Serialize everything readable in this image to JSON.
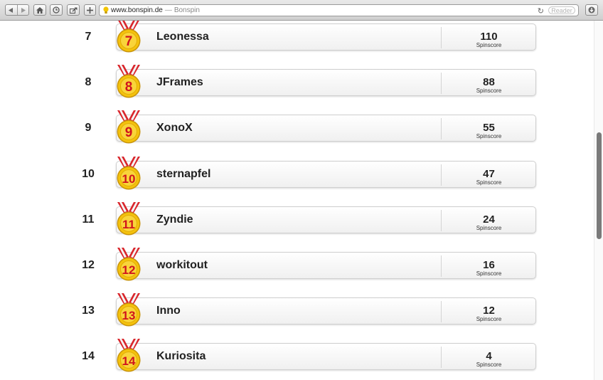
{
  "browser": {
    "address": "www.bonspin.de",
    "separator": "—",
    "site_title": "Bonspin",
    "reader_label": "Reader"
  },
  "score_label": "Spinscore",
  "rows": [
    {
      "rank": "7",
      "medal": "7",
      "name": "Leonessa",
      "score": "110"
    },
    {
      "rank": "8",
      "medal": "8",
      "name": "JFrames",
      "score": "88"
    },
    {
      "rank": "9",
      "medal": "9",
      "name": "XonoX",
      "score": "55"
    },
    {
      "rank": "10",
      "medal": "10",
      "name": "sternapfel",
      "score": "47"
    },
    {
      "rank": "11",
      "medal": "11",
      "name": "Zyndie",
      "score": "24"
    },
    {
      "rank": "12",
      "medal": "12",
      "name": "workitout",
      "score": "16"
    },
    {
      "rank": "13",
      "medal": "13",
      "name": "Inno",
      "score": "12"
    },
    {
      "rank": "14",
      "medal": "14",
      "name": "Kuriosita",
      "score": "4"
    }
  ],
  "icons": {
    "back": "back-arrow-icon",
    "forward": "forward-arrow-icon",
    "home": "home-icon",
    "history": "history-clock-icon",
    "share": "share-icon",
    "add": "plus-icon",
    "favicon": "lightbulb-icon",
    "reload": "reload-icon",
    "downloads": "download-icon",
    "medal": "medal-icon"
  },
  "colors": {
    "medal_gold": "#f4c20d",
    "medal_number": "#d0141c",
    "ribbon_red": "#d9262c"
  }
}
